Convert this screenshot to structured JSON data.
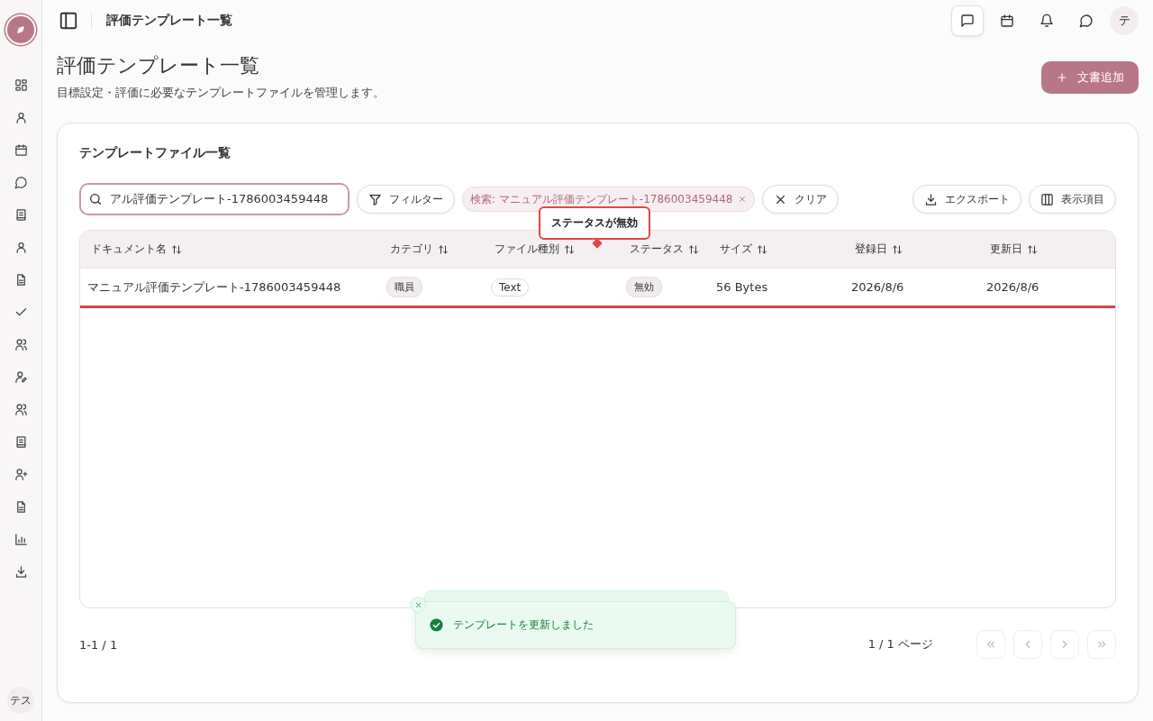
{
  "topbar": {
    "title": "評価テンプレート一覧",
    "actions": [
      {
        "selected": true
      },
      {
        "selected": false
      },
      {
        "selected": false
      },
      {
        "selected": false
      }
    ],
    "avatar": "テ"
  },
  "page": {
    "title": "評価テンプレート一覧",
    "subtitle": "目標設定・評価に必要なテンプレートファイルを管理します。",
    "add_button": "文書追加"
  },
  "card": {
    "title": "テンプレートファイル一覧",
    "search": {
      "value": "アル評価テンプレート-1786003459448",
      "focused": true
    },
    "filter_button": "フィルター",
    "filter_chip": "検索: マニュアル評価テンプレート-1786003459448",
    "clear_button": "クリア",
    "export_button": "エクスポート",
    "columns_button": "表示項目",
    "table": {
      "columns": [
        "ドキュメント名",
        "カテゴリ",
        "ファイル種別",
        "ステータス",
        "サイズ",
        "登録日",
        "更新日"
      ],
      "rows": [
        {
          "name": "マニュアル評価テンプレート-1786003459448",
          "category": "職員",
          "file_type": "Text",
          "status": "無効",
          "size": "56 Bytes",
          "created": "2026/8/6",
          "updated": "2026/8/6",
          "flagged": true
        }
      ]
    },
    "tooltip": "ステータスが無効",
    "range": "1-1 / 1",
    "page_info": "1 / 1 ページ",
    "pager": [
      {
        "kind": "first",
        "disabled": true
      },
      {
        "kind": "prev",
        "disabled": true
      },
      {
        "kind": "next",
        "disabled": true
      },
      {
        "kind": "last",
        "disabled": true
      }
    ]
  },
  "toast": {
    "message": "テンプレートを更新しました"
  },
  "sidebar": {
    "avatar": "テス"
  }
}
